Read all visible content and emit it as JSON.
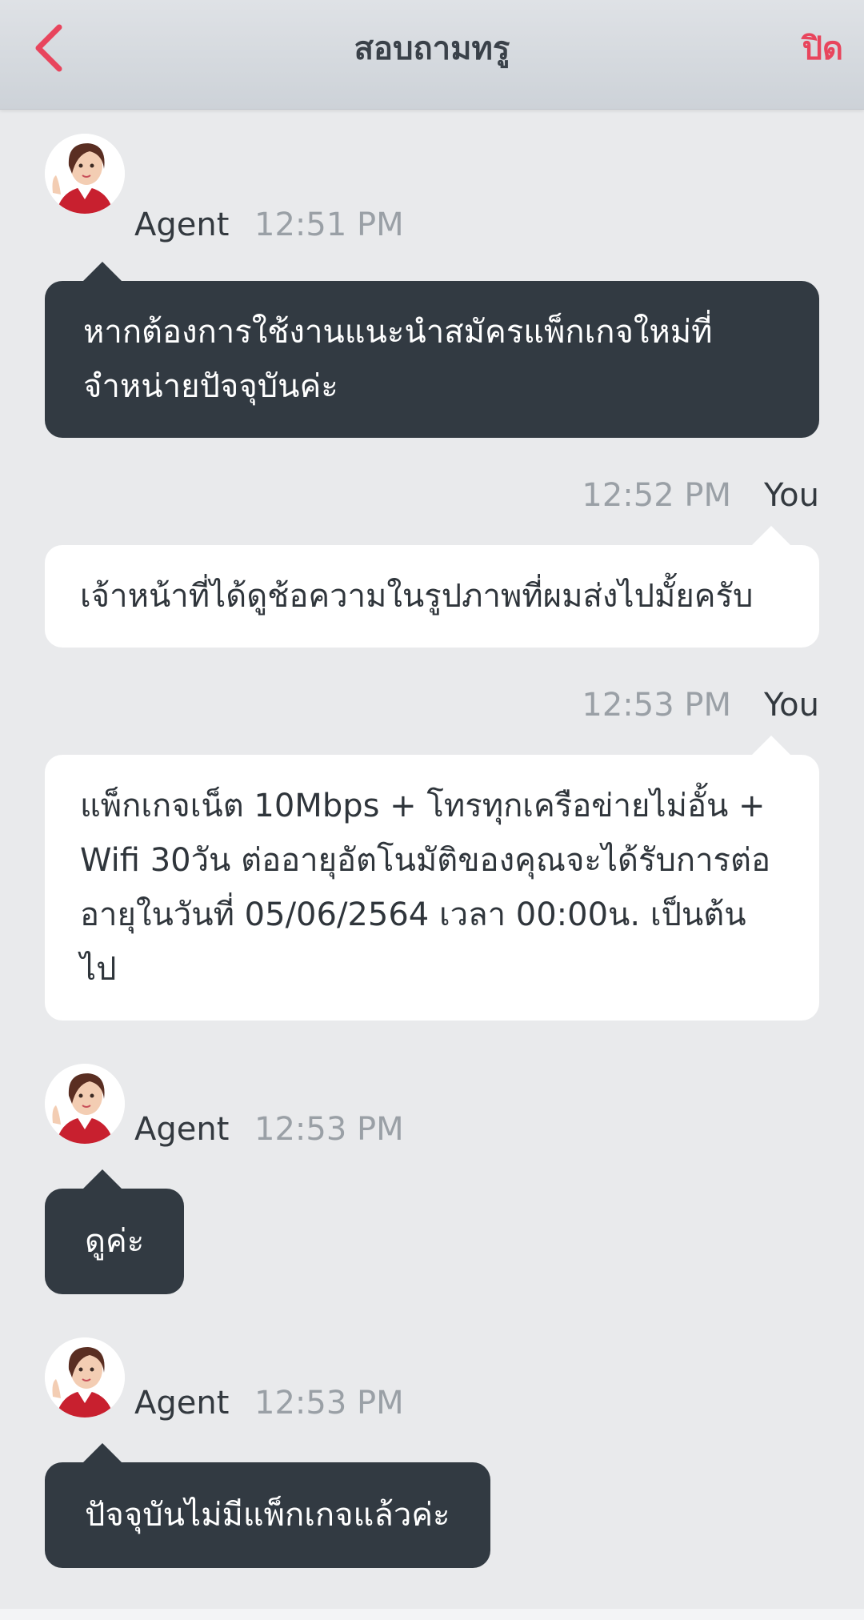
{
  "header": {
    "title": "สอบถามทรู",
    "close_label": "ปิด",
    "accent_color": "#e8455d"
  },
  "messages": [
    {
      "sender": "Agent",
      "time": "12:51 PM",
      "text": "หากต้องการใช้งานแนะนำสมัครแพ็กเกจใหม่ที่จำหน่ายปัจจุบันค่ะ"
    },
    {
      "sender": "You",
      "time": "12:52 PM",
      "text": "เจ้าหน้าที่ได้ดูช้อความในรูปภาพที่ผมส่งไปมั้ยครับ"
    },
    {
      "sender": "You",
      "time": "12:53 PM",
      "text": "แพ็กเกจเน็ต 10Mbps + โทรทุกเครือข่ายไม่อั้น + Wifi 30วัน ต่ออายุอัตโนมัติของคุณจะได้รับการต่ออายุในวันที่ 05/06/2564 เวลา 00:00น. เป็นต้นไป"
    },
    {
      "sender": "Agent",
      "time": "12:53 PM",
      "text": "ดูค่ะ"
    },
    {
      "sender": "Agent",
      "time": "12:53 PM",
      "text": "ปัจจุบันไม่มีแพ็กเกจแล้วค่ะ"
    }
  ]
}
